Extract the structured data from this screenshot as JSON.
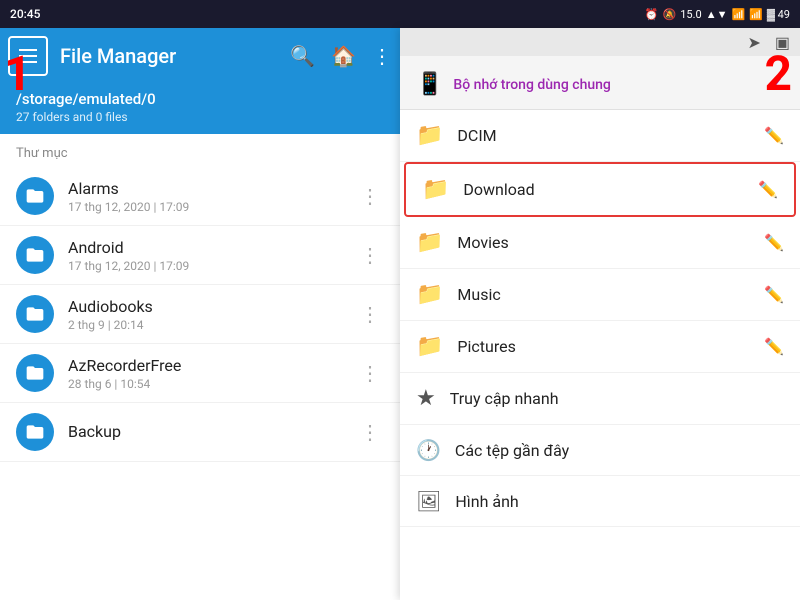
{
  "statusBar": {
    "time": "20:45",
    "icons": [
      "⏰",
      "🔔",
      "15.0",
      "📶",
      "📶",
      "🔋"
    ],
    "battery": "49"
  },
  "appBar": {
    "title": "File Manager",
    "hamburgerLabel": "Menu",
    "searchLabel": "Search",
    "homeLabel": "Home",
    "moreLabel": "More options"
  },
  "pathBar": {
    "path": "/storage/emulated/0",
    "subtitle": "27 folders and 0 files"
  },
  "sectionHeader": "Thư mục",
  "fileList": [
    {
      "name": "Alarms",
      "date": "17 thg 12, 2020 | 17:09"
    },
    {
      "name": "Android",
      "date": "17 thg 12, 2020 | 17:09"
    },
    {
      "name": "Audiobooks",
      "date": "2 thg 9 | 20:14"
    },
    {
      "name": "AzRecorderFree",
      "date": "28 thg 6 | 10:54"
    },
    {
      "name": "Backup",
      "date": ""
    }
  ],
  "labels": {
    "label1": "1",
    "label2": "2"
  },
  "drawer": {
    "storageLabel": "Bộ nhớ trong dùng chung",
    "folders": [
      {
        "name": "DCIM",
        "highlighted": false
      },
      {
        "name": "Download",
        "highlighted": true
      },
      {
        "name": "Movies",
        "highlighted": false
      },
      {
        "name": "Music",
        "highlighted": false
      },
      {
        "name": "Pictures",
        "highlighted": false
      }
    ],
    "quickAccess": [
      {
        "name": "Truy cập nhanh",
        "icon": "star"
      },
      {
        "name": "Các tệp gần đây",
        "icon": "history"
      },
      {
        "name": "Hình ảnh",
        "icon": "image"
      }
    ]
  }
}
